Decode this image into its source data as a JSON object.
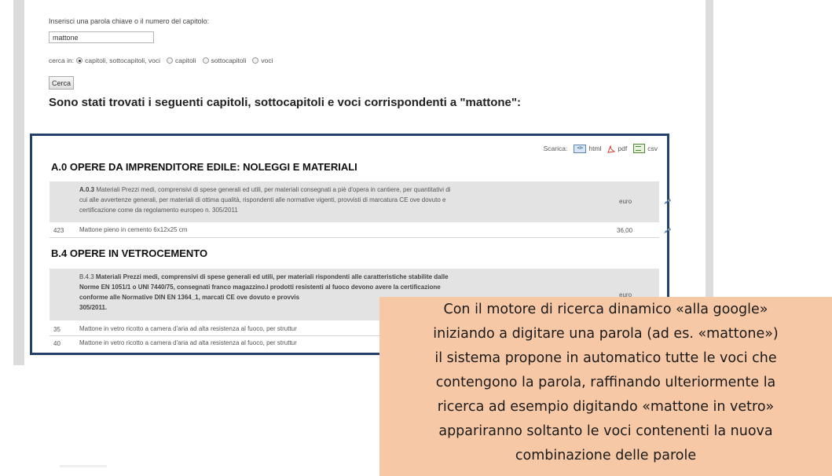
{
  "search": {
    "label": "Inserisci una parola chiave o il numero del capitolo:",
    "input_value": "mattone",
    "scope_prefix": "cerca in:",
    "scope_options": [
      "capitoli, sottocapitoli, voci",
      "capitoli",
      "sottocapitoli",
      "voci"
    ],
    "scope_selected": "capitoli, sottocapitoli, voci",
    "button_label": "Cerca"
  },
  "results": {
    "heading": "Sono stati trovati i seguenti capitoli, sottocapitoli e voci corrispondenti a \"mattone\":",
    "download": {
      "label": "Scarica:",
      "formats": [
        "html",
        "pdf",
        "csv"
      ]
    },
    "sections": [
      {
        "title": "A.0 OPERE DA IMPRENDITORE EDILE: NOLEGGI E MATERIALI",
        "subchapter": {
          "code": "A.0.3",
          "lines": [
            "Materiali Prezzi medi, comprensivi di spese generali ed utili, per materiali consegnati a piè d'opera in cantiere, per quantitativi di",
            "cui alle avvertenze generali, per materiali di ottima qualità, rispondenti alle normative vigenti, provvisti di marcatura CE ove dovuto e",
            "certificazione come da regolamento europeo n. 305/2011"
          ],
          "unit": "euro"
        },
        "items": [
          {
            "num": "423",
            "text": "Mattone pieno in cemento 6x12x25 cm",
            "price": "36,00"
          }
        ]
      },
      {
        "title": "B.4 OPERE IN VETROCEMENTO",
        "subchapter": {
          "code": "B.4.3",
          "lines": [
            "Materiali Prezzi medi, comprensivi di spese generali ed utili, per materiali rispondenti alle caratteristiche stabilite dalle",
            "Norme EN 1051/1 o UNI 7440/75, consegnati franco magazzino.I prodotti resistenti al fuoco devono avere la certificazione",
            "conforme alle Normative DIN EN 1364_1, marcati CE ove dovuto e provvis",
            "305/2011."
          ],
          "unit": "euro"
        },
        "items": [
          {
            "num": "35",
            "text": "Mattone in vetro ricotto a camera d'aria ad alta resistenza al fuoco, per struttur"
          },
          {
            "num": "40",
            "text": "Mattone in vetro ricotto a camera d'aria ad alta resistenza al fuoco, per struttur"
          }
        ]
      }
    ]
  },
  "callout": {
    "lines": [
      "Con il motore di ricerca dinamico «alla google»",
      "iniziando a digitare una parola (ad es. «mattone»)",
      "il sistema propone in automatico  tutte le voci che",
      "contengono la parola, raffinando ulteriormente la",
      "ricerca ad esempio digitando «mattone in vetro»",
      "appariranno soltanto le voci contenenti la nuova",
      "combinazione delle parole"
    ]
  },
  "colors": {
    "box_border": "#25406a",
    "callout_bg": "#f6c8a6",
    "row_grey": "#e3e3e3"
  }
}
